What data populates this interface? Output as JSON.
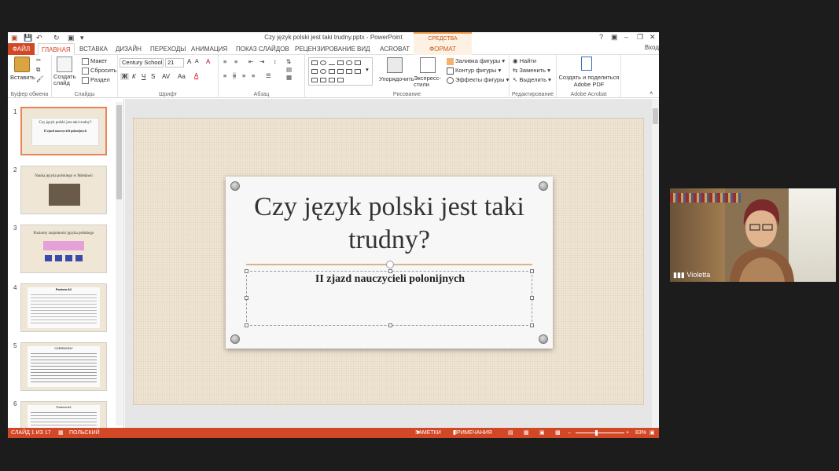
{
  "window": {
    "doc_title": "Czy język polski jest taki trudny.pptx - PowerPoint",
    "context_group": "СРЕДСТВА РИСОВАНИЯ",
    "controls": [
      "?",
      "▣",
      "–",
      "❐",
      "✕"
    ]
  },
  "tabs": [
    "ФАЙЛ",
    "ГЛАВНАЯ",
    "ВСТАВКА",
    "ДИЗАЙН",
    "ПЕРЕХОДЫ",
    "АНИМАЦИЯ",
    "ПОКАЗ СЛАЙДОВ",
    "РЕЦЕНЗИРОВАНИЕ",
    "ВИД",
    "ACROBAT",
    "ФОРМАТ"
  ],
  "signin": "Вход",
  "ribbon": {
    "clipboard": {
      "label": "Буфер обмена",
      "paste": "Вставить"
    },
    "slides": {
      "label": "Слайды",
      "new_slide": "Создать слайд",
      "layout": "Макет",
      "reset": "Сбросить",
      "section": "Раздел"
    },
    "font": {
      "label": "Шрифт",
      "name": "Century School",
      "size": "21",
      "bold": "Ж",
      "italic": "К",
      "underline": "Ч",
      "strike": "S",
      "case": "Aa",
      "grow": "A",
      "shrink": "A",
      "clear": "A",
      "color": "A",
      "spacing": "AV"
    },
    "paragraph": {
      "label": "Абзац"
    },
    "drawing": {
      "label": "Рисование",
      "arrange": "Упорядочить",
      "quick_styles": "Экспресс-стили",
      "fill": "Заливка фигуры",
      "outline": "Контур фигуры",
      "effects": "Эффекты фигуры"
    },
    "editing": {
      "label": "Редактирование",
      "find": "Найти",
      "replace": "Заменить",
      "select": "Выделить"
    },
    "acrobat": {
      "label": "Adobe Acrobat",
      "create": "Создать и поделиться Adobe PDF"
    }
  },
  "thumbnails": [
    {
      "num": "1",
      "title": "Czy język polski jest taki trudny?",
      "sub": "II zjazd nauczycieli polonijnych"
    },
    {
      "num": "2",
      "title": "Nauka języka polskiego w Mołdawii",
      "sub": ""
    },
    {
      "num": "3",
      "title": "Poziomy znajomości języka polskiego",
      "sub": ""
    },
    {
      "num": "4",
      "title": "Poziom A1",
      "sub": ""
    },
    {
      "num": "5",
      "title": "CZERWONY",
      "sub": ""
    },
    {
      "num": "6",
      "title": "Poziom A2",
      "sub": ""
    }
  ],
  "slide": {
    "title": "Czy język polski jest taki trudny?",
    "subtitle": "II zjazd nauczycieli polonijnych"
  },
  "status": {
    "slide_of": "СЛАЙД 1 ИЗ 17",
    "language": "ПОЛЬСКИЙ",
    "notes": "ЗАМЕТКИ",
    "comments": "ПРИМЕЧАНИЯ",
    "zoom": "83%"
  },
  "video": {
    "participant": "Violetta"
  }
}
